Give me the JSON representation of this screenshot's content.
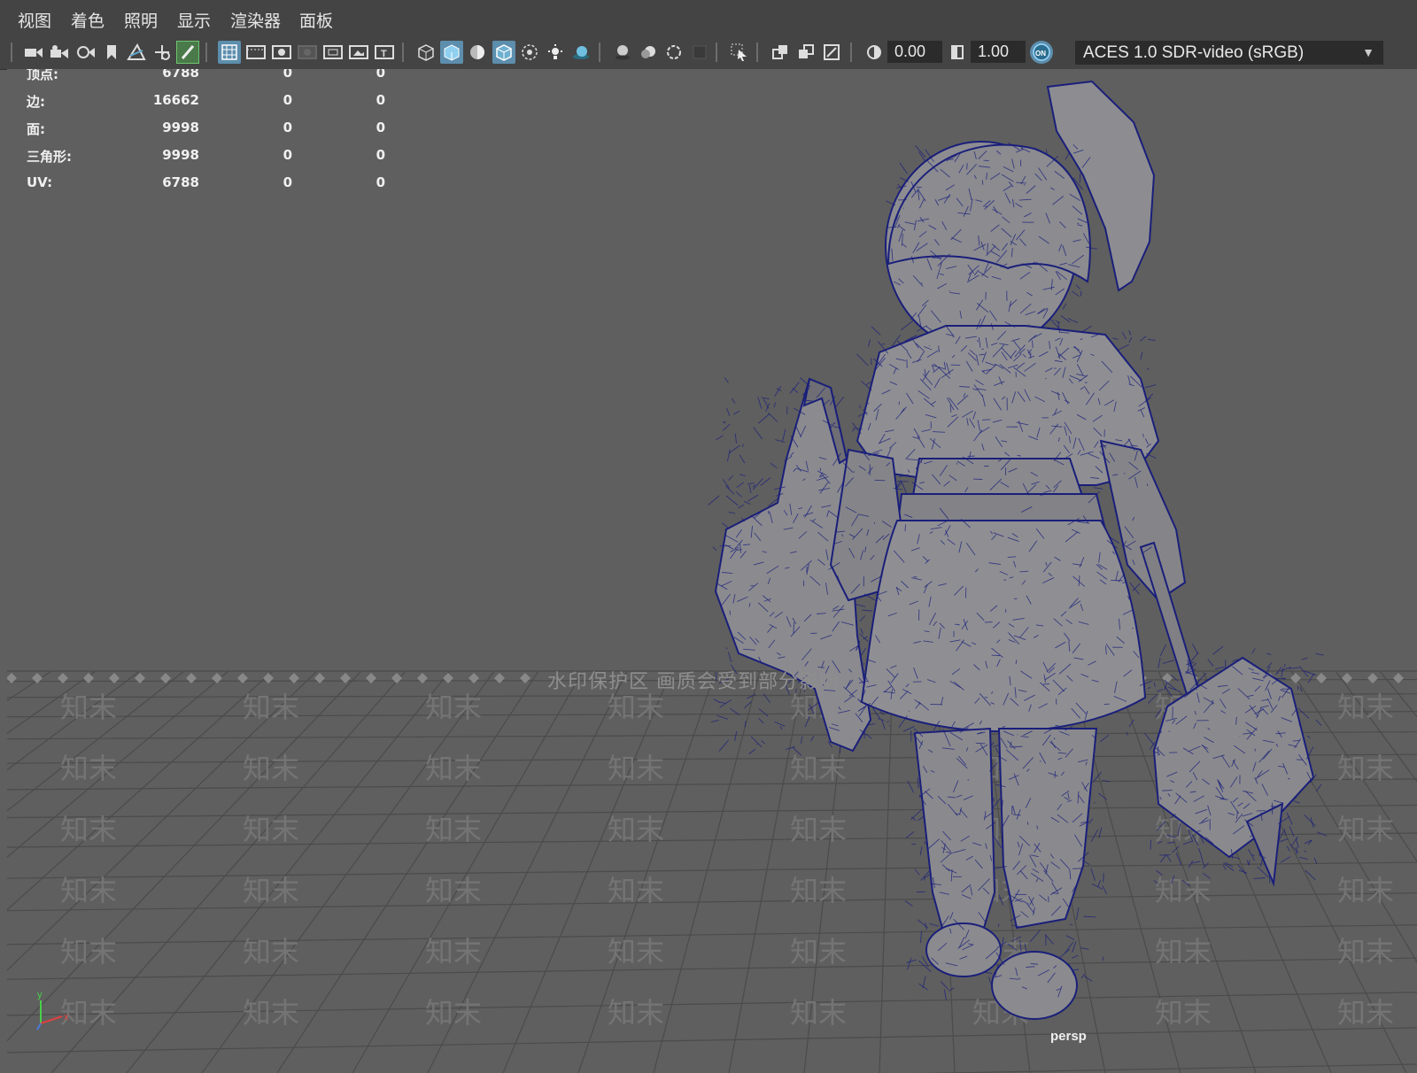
{
  "menu": [
    "视图",
    "着色",
    "照明",
    "显示",
    "渲染器",
    "面板"
  ],
  "toolbar": {
    "exposure_value": "0.00",
    "gamma_value": "1.00",
    "color_space": "ACES 1.0 SDR-video (sRGB)",
    "icons": [
      "camera-select-icon",
      "camera-attributes-icon",
      "camera-bookmark-icon",
      "bookmark-icon",
      "image-plane-icon",
      "2d-pan-zoom-icon",
      "grease-pencil-icon",
      "grid-icon",
      "film-gate-icon",
      "resolution-gate-icon",
      "gate-mask-icon",
      "field-chart-icon",
      "safe-action-icon",
      "safe-title-icon",
      "wireframe-icon",
      "smooth-shade-icon",
      "default-material-icon",
      "wireframe-on-shaded-icon",
      "xray-icon",
      "use-all-lights-icon",
      "shadows-icon",
      "screen-space-ao-icon",
      "motion-blur-icon",
      "anti-aliasing-icon",
      "depth-of-field-icon",
      "isolate-select-icon",
      "xray-joints-icon",
      "xray-active-icon",
      "backface-culling-icon",
      "exposure-icon",
      "gamma-icon",
      "color-management-icon"
    ]
  },
  "hud": [
    {
      "label": "顶点:",
      "v1": "6788",
      "v2": "0",
      "v3": "0"
    },
    {
      "label": "边:",
      "v1": "16662",
      "v2": "0",
      "v3": "0"
    },
    {
      "label": "面:",
      "v1": "9998",
      "v2": "0",
      "v3": "0"
    },
    {
      "label": "三角形:",
      "v1": "9998",
      "v2": "0",
      "v3": "0"
    },
    {
      "label": "UV:",
      "v1": "6788",
      "v2": "0",
      "v3": "0"
    }
  ],
  "viewport": {
    "camera": "persp",
    "watermark_banner": "水印保护区  画质会受到部分影响",
    "watermark_text": "知末",
    "axis": {
      "y": "y",
      "x": "x"
    },
    "model_wire_color": "#1a1f7a",
    "model_fill_color": "#8d8d91"
  }
}
